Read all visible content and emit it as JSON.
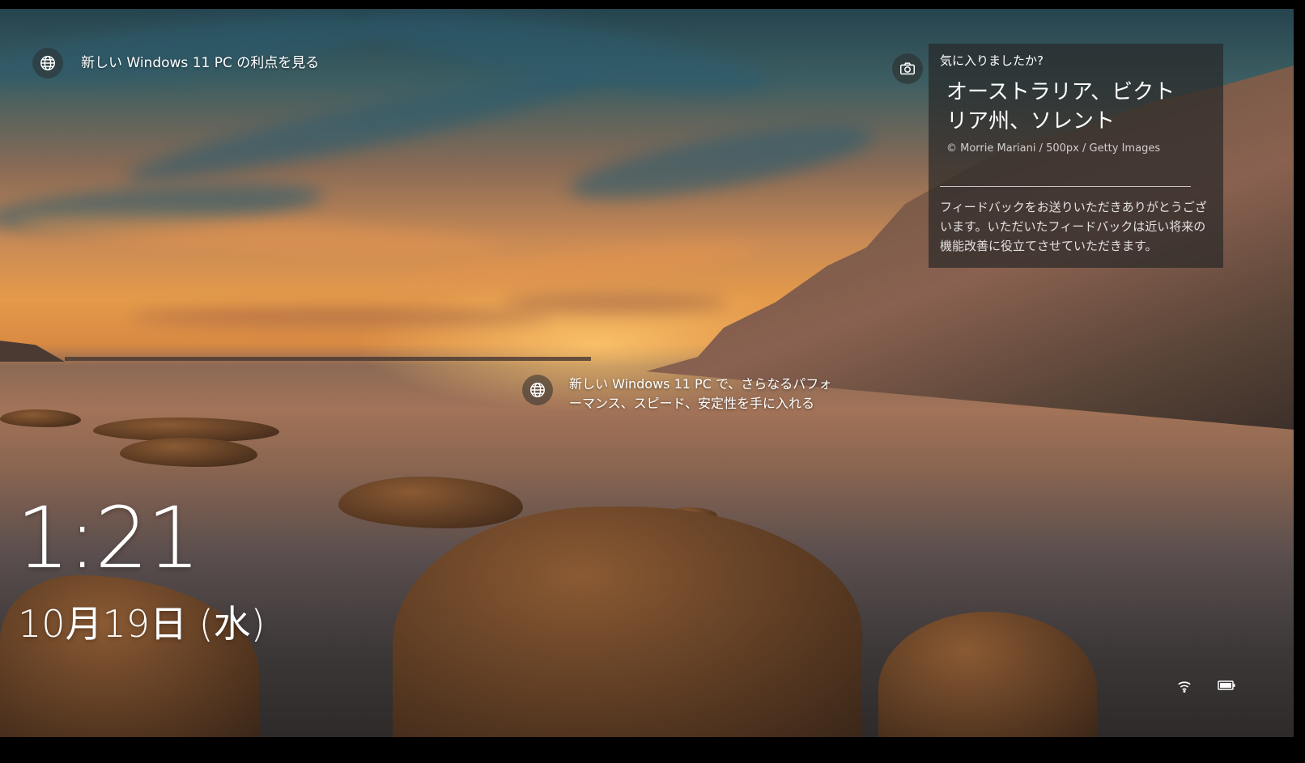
{
  "promo_top": {
    "text": "新しい Windows 11 PC の利点を見る",
    "icon": "globe-icon"
  },
  "promo_mid": {
    "text": "新しい Windows 11 PC で、さらなるパフォーマンス、スピード、安定性を手に入れる",
    "icon": "globe-icon"
  },
  "spotlight": {
    "question": "気に入りましたか?",
    "title": "オーストラリア、ビクトリア州、ソレント",
    "credit": "© Morrie Mariani / 500px / Getty Images",
    "thanks": "フィードバックをお送りいただきありがとうございます。いただいたフィードバックは近い将来の機能改善に役立てさせていただきます。",
    "icon": "camera-icon"
  },
  "clock": {
    "time": "1:21",
    "date": "10月19日 (水)"
  },
  "status": {
    "network_icon": "wifi-icon",
    "battery_icon": "battery-icon"
  }
}
